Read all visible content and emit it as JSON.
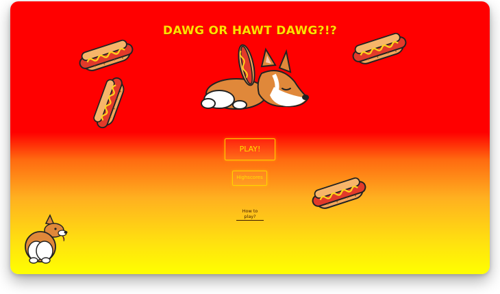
{
  "game": {
    "title": "DAWG OR HAWT DAWG?!?",
    "play_label": "PLAY!",
    "highscores_label": "Highscores",
    "how_to_play_label": "How to play?"
  },
  "colors": {
    "bg_top": "#ff0000",
    "bg_bottom": "#ffff00",
    "accent": "#ffe000",
    "hotdog_bun": "#f3a55a",
    "hotdog_sausage": "#e23a2a",
    "mustard": "#ffd21e",
    "corgi_fur": "#e0883a"
  },
  "icons": [
    "hotdog-icon",
    "sleeping-corgi-icon",
    "corgi-butt-icon"
  ]
}
